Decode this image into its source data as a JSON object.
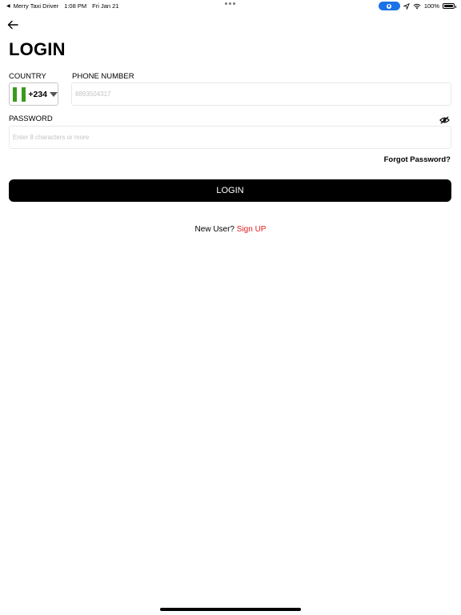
{
  "status_bar": {
    "back_app": "Merry Taxi Driver",
    "time": "1:08 PM",
    "date": "Fri Jan 21",
    "battery": "100%"
  },
  "page": {
    "title": "LOGIN"
  },
  "form": {
    "country_label": "COUNTRY",
    "dial_code": "+234",
    "flag_colors": [
      "#3a9a1c",
      "#ffffff",
      "#3a9a1c"
    ],
    "phone_label": "PHONE NUMBER",
    "phone_placeholder": "8893504317",
    "password_label": "PASSWORD",
    "password_placeholder": "Enter 8 characters or more",
    "forgot_label": "Forgot Password?",
    "login_button": "LOGIN",
    "new_user_text": "New User?",
    "signup_link": "Sign UP",
    "accent_color": "#e02020"
  }
}
